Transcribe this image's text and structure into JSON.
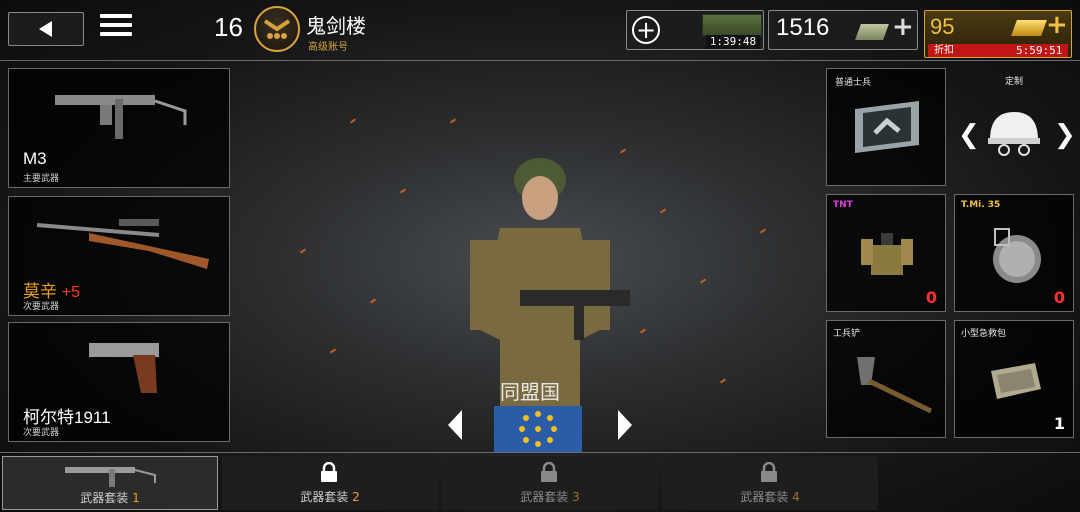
{
  "header": {
    "level": "16",
    "player_name": "鬼剑楼",
    "player_subtitle": "高级账号",
    "crate_timer": "1:39:48",
    "money": "1516",
    "gold": "95",
    "gold_offer_label": "折扣",
    "gold_offer_timer": "5:59:51"
  },
  "weapons": [
    {
      "name": "M3",
      "type": "主要武器",
      "bonus": ""
    },
    {
      "name": "莫辛",
      "type": "次要武器",
      "bonus": "+5"
    },
    {
      "name": "柯尔特1911",
      "type": "次要武器",
      "bonus": ""
    }
  ],
  "right_panel": {
    "rank_slot_label": "普通士兵",
    "customize_label": "定制",
    "items": [
      {
        "label": "TNT",
        "count": "0",
        "label_color": "#e040e0"
      },
      {
        "label": "T.Mi. 35",
        "count": "0",
        "label_color": "#f0c040"
      },
      {
        "label": "工兵铲",
        "count": ""
      },
      {
        "label": "小型急救包",
        "count": "1"
      }
    ]
  },
  "faction": {
    "name": "同盟国"
  },
  "loadouts": [
    {
      "label": "武器套装",
      "num": "1",
      "locked": false,
      "active": true
    },
    {
      "label": "武器套装",
      "num": "2",
      "locked": true,
      "active": false
    },
    {
      "label": "武器套装",
      "num": "3",
      "locked": true,
      "active": false
    },
    {
      "label": "武器套装",
      "num": "4",
      "locked": true,
      "active": false
    }
  ],
  "icons": {
    "back": "back-arrow-icon",
    "menu": "hamburger-menu-icon",
    "rank": "rank-chevron-icon",
    "add": "plus-circle-icon",
    "crate": "supply-crate-icon",
    "money": "cash-stack-icon",
    "gold": "gold-bar-icon",
    "lock": "lock-icon"
  },
  "colors": {
    "accent_gold": "#d8a23c",
    "red_bonus": "#ff3a1a",
    "offer_red": "#c01616",
    "flag_blue": "#2a5ca8"
  }
}
